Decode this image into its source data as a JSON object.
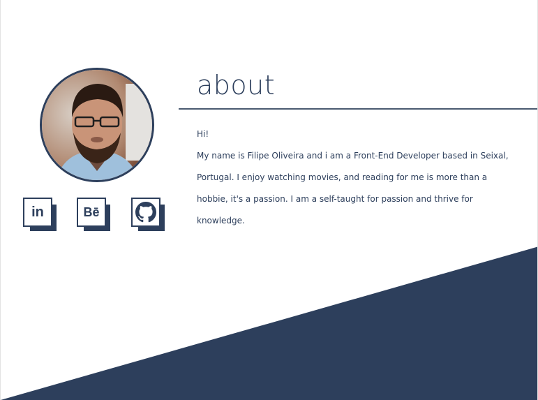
{
  "about": {
    "title": "about",
    "greeting": "Hi!",
    "paragraph": "My name is Filipe Oliveira and i am a Front-End Developer based in Seixal, Portugal. I enjoy watching movies, and reading for me is more than a hobbie, it's a passion. I am a self-taught for passion and thrive for knowledge."
  },
  "social": {
    "linkedin": {
      "label": "in",
      "icon": "linkedin-icon"
    },
    "behance": {
      "label": "Bē",
      "icon": "behance-icon"
    },
    "github": {
      "label": "",
      "icon": "github-icon"
    }
  },
  "colors": {
    "navy": "#2d3f5c",
    "background": "#ffffff"
  }
}
